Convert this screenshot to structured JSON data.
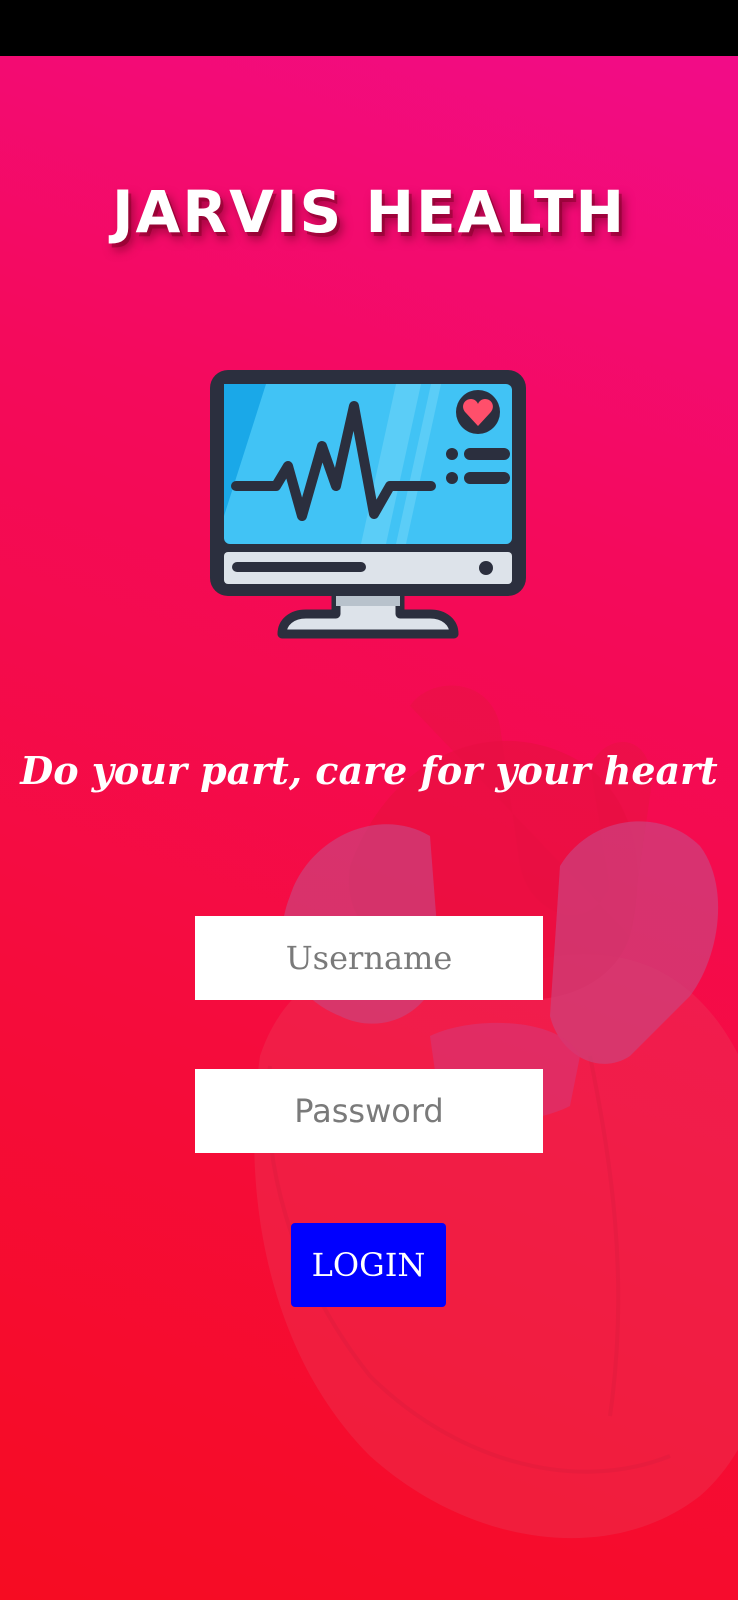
{
  "app": {
    "title": "JARVIS HEALTH",
    "tagline": "Do your part, care for your heart"
  },
  "form": {
    "username_placeholder": "Username",
    "username_value": "",
    "password_placeholder": "Password",
    "password_value": "",
    "login_label": "LOGIN"
  },
  "icons": {
    "logo": "heart-monitor-icon",
    "background": "heart-illustration"
  },
  "colors": {
    "gradient_top": "#f20c88",
    "gradient_bottom": "#f60c22",
    "login_button": "#0000ff",
    "monitor_screen": "#41c3f5",
    "outline": "#2b2f3e"
  }
}
